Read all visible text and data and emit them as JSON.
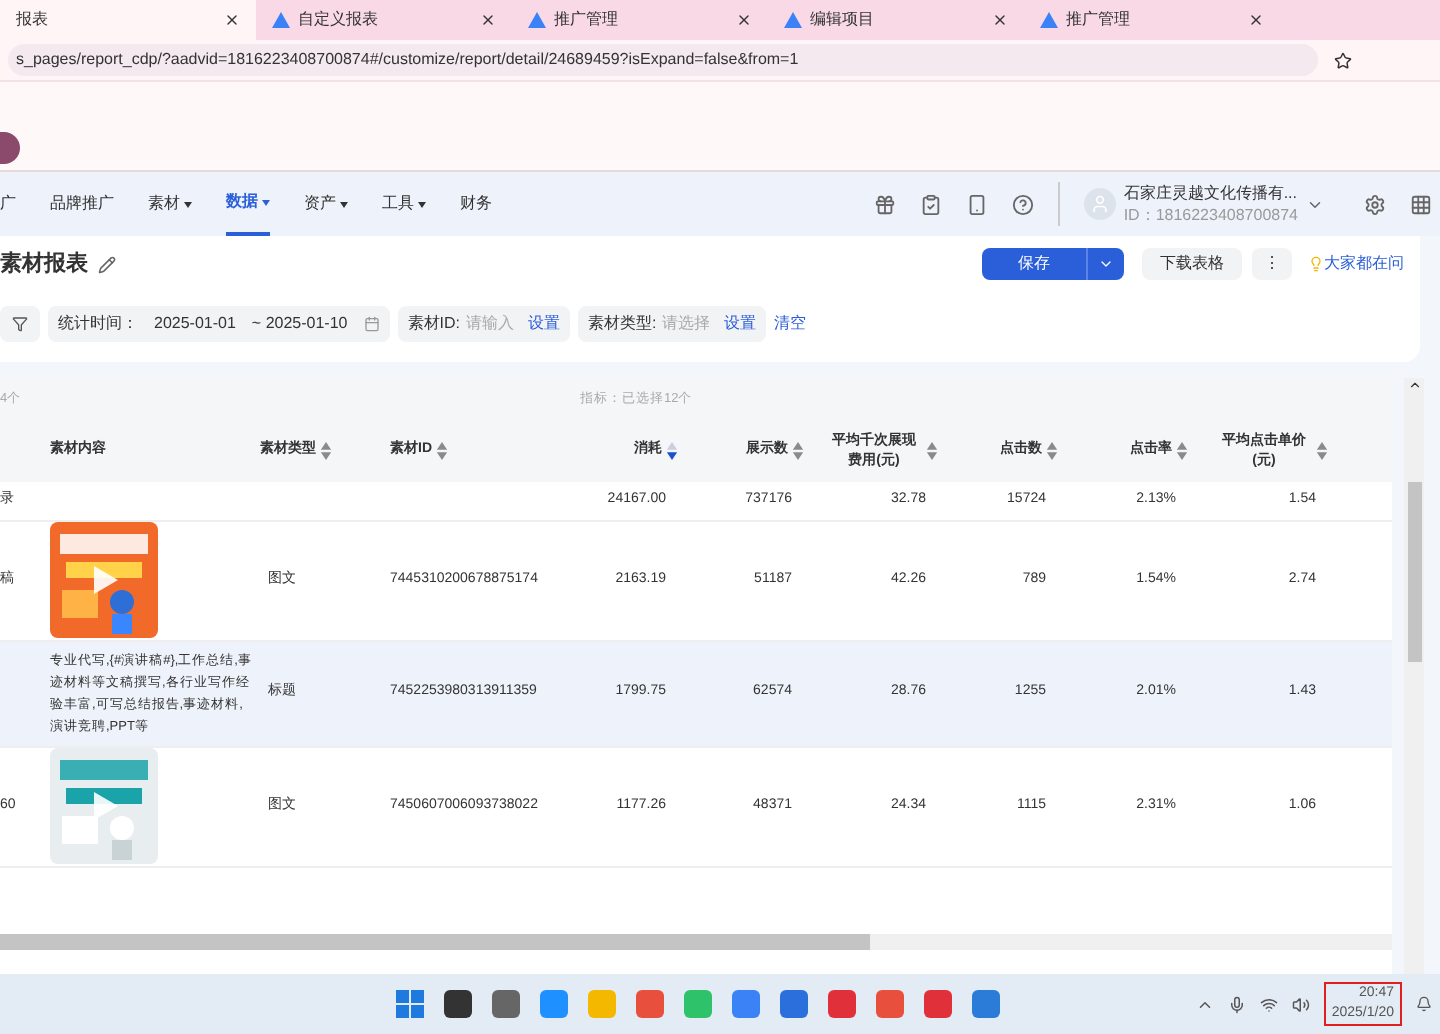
{
  "browser_tabs": [
    {
      "label": "报表",
      "selected": true
    },
    {
      "label": "自定义报表",
      "selected": false
    },
    {
      "label": "推广管理",
      "selected": false
    },
    {
      "label": "编辑项目",
      "selected": false
    },
    {
      "label": "推广管理",
      "selected": false
    }
  ],
  "address": "s_pages/report_cdp/?aadvid=1816223408700874#/customize/report/detail/24689459?isExpand=false&from=1",
  "nav": [
    {
      "label": "广",
      "dropdown": false,
      "selected": false
    },
    {
      "label": "品牌推广",
      "dropdown": false,
      "selected": false
    },
    {
      "label": "素材",
      "dropdown": true,
      "selected": false
    },
    {
      "label": "数据",
      "dropdown": true,
      "selected": true
    },
    {
      "label": "资产",
      "dropdown": true,
      "selected": false
    },
    {
      "label": "工具",
      "dropdown": true,
      "selected": false
    },
    {
      "label": "财务",
      "dropdown": false,
      "selected": false
    }
  ],
  "account": {
    "name": "石家庄灵越文化传播有...",
    "id": "ID：1816223408700874"
  },
  "page_title": "素材报表",
  "actions": {
    "save": "保存",
    "download": "下载表格",
    "more": "⋮",
    "help": "大家都在问"
  },
  "filters": {
    "date_label": "统计时间：",
    "date_from": "2025-01-01",
    "date_to": "~ 2025-01-10",
    "id_label": "素材ID:",
    "id_placeholder": "请输入",
    "id_set": "设置",
    "type_label": "素材类型:",
    "type_placeholder": "请选择",
    "type_set": "设置",
    "clear": "清空"
  },
  "table": {
    "count": "4个",
    "metrics": "指标：已选择12个",
    "columns": [
      {
        "label": "素材内容"
      },
      {
        "label": "素材类型",
        "sortable": true,
        "sorted": false
      },
      {
        "label": "素材ID",
        "sortable": true,
        "sorted": false
      },
      {
        "label": "消耗",
        "sortable": true,
        "sorted": true
      },
      {
        "label": "展示数",
        "sortable": true,
        "sorted": false
      },
      {
        "label": "平均千次展现费用(元)",
        "sortable": true,
        "sorted": false
      },
      {
        "label": "点击数",
        "sortable": true,
        "sorted": false
      },
      {
        "label": "点击率",
        "sortable": true,
        "sorted": false
      },
      {
        "label": "平均点击单价(元)",
        "sortable": true,
        "sorted": false
      }
    ],
    "rows": [
      {
        "kind": "total",
        "row_label": "录",
        "cells": [
          "",
          "",
          "",
          "24167.00",
          "737176",
          "32.78",
          "15724",
          "2.13%",
          "1.54"
        ],
        "highlighted": false
      },
      {
        "row_label": "稿",
        "cells": [
          "",
          "图文",
          "7445310200678875174",
          "2163.19",
          "51187",
          "42.26",
          "789",
          "1.54%",
          "2.74"
        ],
        "highlighted": false
      },
      {
        "kind": "text",
        "cells": [
          "专业代写,{#演讲稿#},工作总结,事迹材料等文稿撰写,各行业写作经验丰富,可写总结报告,事迹材料,演讲竞聘,PPT等",
          "标题",
          "7452253980313911359",
          "1799.75",
          "62574",
          "28.76",
          "1255",
          "2.01%",
          "1.43"
        ],
        "highlighted": true
      },
      {
        "row_label": "60",
        "cells": [
          "",
          "图文",
          "7450607006093738022",
          "1177.26",
          "48371",
          "24.34",
          "1115",
          "2.31%",
          "1.06"
        ],
        "highlighted": false
      }
    ]
  },
  "clock": {
    "time": "20:47",
    "date": "2025/1/20"
  }
}
